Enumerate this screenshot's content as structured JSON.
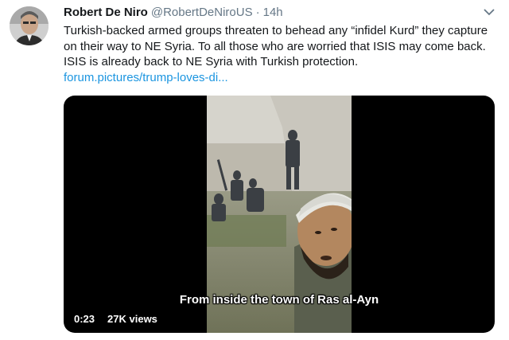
{
  "tweet": {
    "author_name": "Robert De Niro",
    "handle": "@RobertDeNiroUS",
    "separator": "·",
    "time": "14h",
    "text": "Turkish-backed armed groups threaten to behead any “infidel Kurd” they capture on their way to NE Syria. To all those who are worried that ISIS may come back. ISIS is already back to NE Syria with Turkish protection.",
    "link": "forum.pictures/trump-loves-di...",
    "link_color": "#1b95e0"
  },
  "media": {
    "subtitle": "From inside the town of Ras al-Ayn",
    "duration": "0:23",
    "views": "27K views"
  },
  "icons": {
    "more": "chevron-down-icon",
    "avatar": "avatar-photo"
  }
}
